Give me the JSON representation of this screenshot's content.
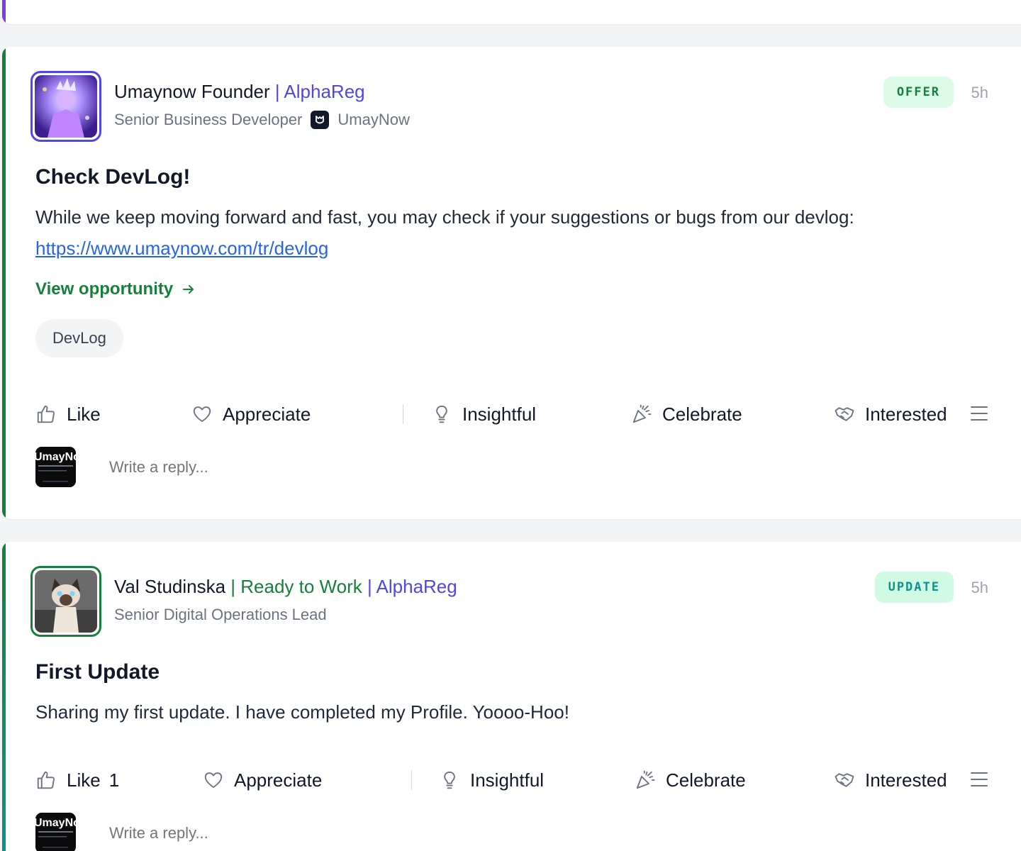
{
  "posts": [
    {
      "author": "Umaynow Founder",
      "tags": [
        "| AlphaReg"
      ],
      "role": "Senior Business Developer",
      "company": "UmayNow",
      "badge": "OFFER",
      "time": "5h",
      "title": "Check DevLog!",
      "body": "While we keep moving forward and fast, you may check if your suggestions or bugs from our devlog: ",
      "link": "https://www.umaynow.com/tr/devlog",
      "cta": "View opportunity",
      "chip": "DevLog",
      "reactions": {
        "like": "Like",
        "appreciate": "Appreciate",
        "insightful": "Insightful",
        "celebrate": "Celebrate",
        "interested": "Interested"
      },
      "reply_placeholder": "Write a reply..."
    },
    {
      "author": "Val Studinska",
      "tags": [
        "| Ready to Work",
        "| AlphaReg"
      ],
      "role": "Senior Digital Operations Lead",
      "badge": "UPDATE",
      "time": "5h",
      "title": "First Update",
      "body": "Sharing my first update. I have completed my Profile. Yoooo-Hoo!",
      "reactions": {
        "like": "Like",
        "like_count": "1",
        "appreciate": "Appreciate",
        "insightful": "Insightful",
        "celebrate": "Celebrate",
        "interested": "Interested"
      },
      "reply_placeholder": "Write a reply..."
    }
  ],
  "reply_avatar_text": "UmayNow",
  "colors": {
    "accent_purple": "#4f46e5",
    "accent_green": "#15803d",
    "link_blue": "#2563eb",
    "badge_offer_bg": "#dcfce7",
    "badge_update_bg": "#d1fae5"
  }
}
